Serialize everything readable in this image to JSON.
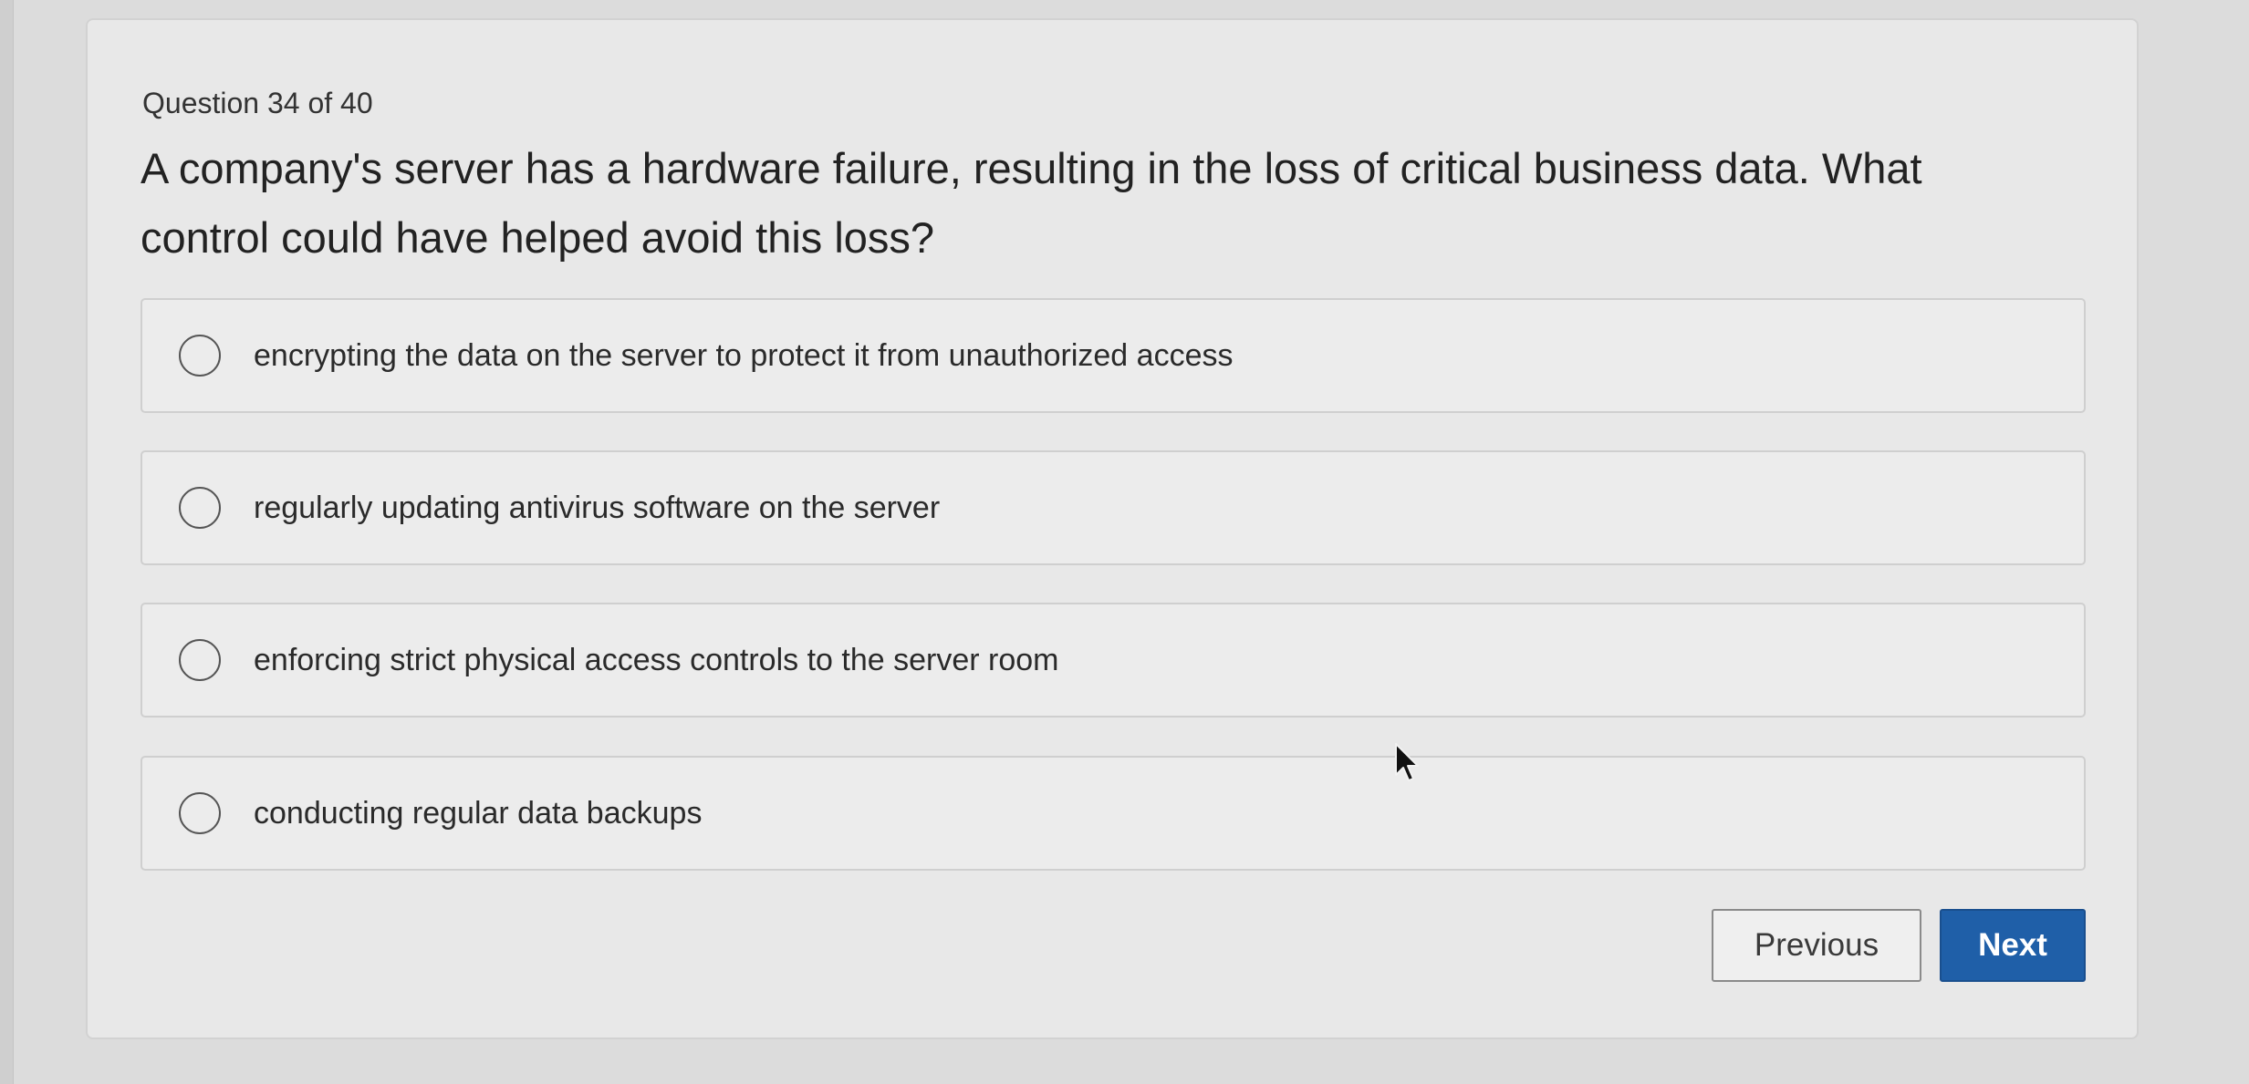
{
  "question": {
    "counter": "Question 34 of 40",
    "text": "A company's server has a hardware failure, resulting in the loss of critical business data. What control could have helped avoid this loss?"
  },
  "options": [
    {
      "label": "encrypting the data on the server to protect it from unauthorized access",
      "selected": false
    },
    {
      "label": "regularly updating antivirus software on the server",
      "selected": false
    },
    {
      "label": "enforcing strict physical access controls to the server room",
      "selected": false
    },
    {
      "label": "conducting regular data backups",
      "selected": false
    }
  ],
  "buttons": {
    "previous_label": "Previous",
    "next_label": "Next"
  },
  "colors": {
    "primary": "#1f5fa8",
    "background": "#dcdcdc",
    "card": "#e8e8e8"
  },
  "icons": {
    "cursor": "mouse-pointer-icon",
    "radio": "radio-circle-icon"
  }
}
